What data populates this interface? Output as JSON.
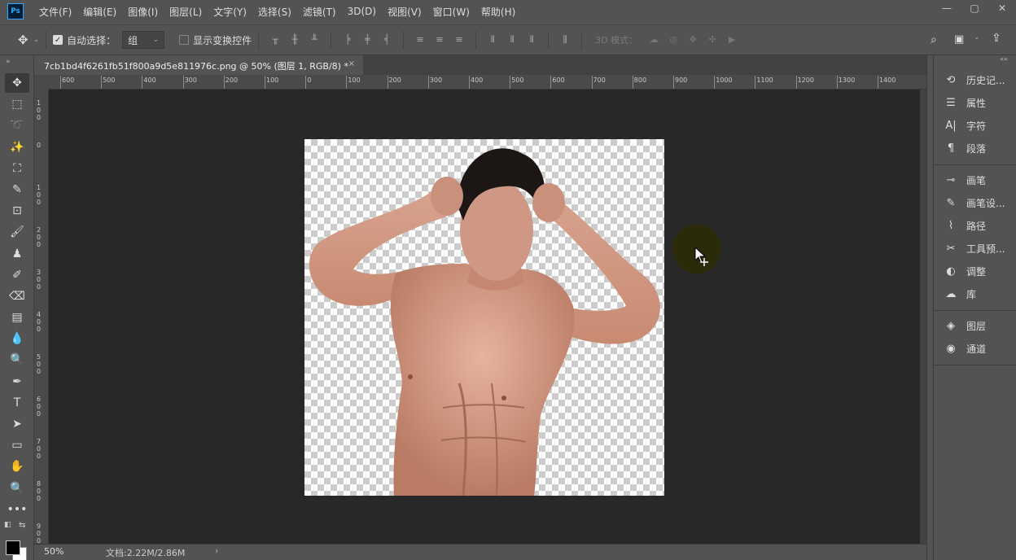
{
  "app": {
    "logo_text": "Ps"
  },
  "menu": [
    "文件(F)",
    "编辑(E)",
    "图像(I)",
    "图层(L)",
    "文字(Y)",
    "选择(S)",
    "滤镜(T)",
    "3D(D)",
    "视图(V)",
    "窗口(W)",
    "帮助(H)"
  ],
  "window_controls": {
    "minimize": "—",
    "restore": "▢",
    "close": "✕"
  },
  "options": {
    "auto_select_label": "自动选择：",
    "auto_select_checked": true,
    "group_value": "组",
    "show_transform_label": "显示变换控件",
    "show_transform_checked": false,
    "mode_3d_label": "3D 模式："
  },
  "document": {
    "tab_title": "7cb1bd4f6261fb51f800a9d5e811976c.png @ 50% (图层 1, RGB/8) *",
    "close_glyph": "×"
  },
  "rulers": {
    "top_labels": [
      "600",
      "500",
      "400",
      "300",
      "200",
      "100",
      "0",
      "100",
      "200",
      "300",
      "400",
      "500",
      "600",
      "700",
      "800",
      "900",
      "1000",
      "1100",
      "1200",
      "1300",
      "1400"
    ],
    "left_labels": [
      "100",
      "0",
      "100",
      "200",
      "300",
      "400",
      "500",
      "600",
      "700",
      "800",
      "900"
    ]
  },
  "tools": [
    {
      "name": "move-tool-icon",
      "glyph": "✥",
      "active": true
    },
    {
      "name": "marquee-tool-icon",
      "glyph": "⬚"
    },
    {
      "name": "lasso-tool-icon",
      "glyph": "➰"
    },
    {
      "name": "magic-wand-tool-icon",
      "glyph": "✨"
    },
    {
      "name": "crop-tool-icon",
      "glyph": "⛶"
    },
    {
      "name": "eyedropper-tool-icon",
      "glyph": "✎"
    },
    {
      "name": "patch-tool-icon",
      "glyph": "⊡"
    },
    {
      "name": "brush-tool-icon",
      "glyph": "🖌"
    },
    {
      "name": "clone-stamp-tool-icon",
      "glyph": "♟"
    },
    {
      "name": "history-brush-tool-icon",
      "glyph": "✐"
    },
    {
      "name": "eraser-tool-icon",
      "glyph": "⌫"
    },
    {
      "name": "gradient-tool-icon",
      "glyph": "▤"
    },
    {
      "name": "blur-tool-icon",
      "glyph": "💧"
    },
    {
      "name": "dodge-tool-icon",
      "glyph": "🔍"
    },
    {
      "name": "pen-tool-icon",
      "glyph": "✒"
    },
    {
      "name": "type-tool-icon",
      "glyph": "T"
    },
    {
      "name": "path-selection-tool-icon",
      "glyph": "➤"
    },
    {
      "name": "rectangle-tool-icon",
      "glyph": "▭"
    },
    {
      "name": "hand-tool-icon",
      "glyph": "✋"
    },
    {
      "name": "zoom-tool-icon",
      "glyph": "🔍"
    },
    {
      "name": "more-tools-icon",
      "glyph": "•••"
    }
  ],
  "panels": [
    [
      {
        "name": "history-panel",
        "icon": "history-icon",
        "glyph": "⟲",
        "label": "历史记..."
      },
      {
        "name": "properties-panel",
        "icon": "properties-icon",
        "glyph": "☰",
        "label": "属性"
      },
      {
        "name": "character-panel",
        "icon": "character-icon",
        "glyph": "A|",
        "label": "字符"
      },
      {
        "name": "paragraph-panel",
        "icon": "paragraph-icon",
        "glyph": "¶",
        "label": "段落"
      }
    ],
    [
      {
        "name": "brush-panel",
        "icon": "brush-icon",
        "glyph": "⊸",
        "label": "画笔"
      },
      {
        "name": "brush-settings-panel",
        "icon": "brush-settings-icon",
        "glyph": "✎",
        "label": "画笔设..."
      },
      {
        "name": "paths-panel",
        "icon": "paths-icon",
        "glyph": "⌇",
        "label": "路径"
      },
      {
        "name": "tool-presets-panel",
        "icon": "tool-presets-icon",
        "glyph": "✂",
        "label": "工具预..."
      },
      {
        "name": "adjustments-panel",
        "icon": "adjustments-icon",
        "glyph": "◐",
        "label": "调整"
      },
      {
        "name": "libraries-panel",
        "icon": "libraries-icon",
        "glyph": "☁",
        "label": "库"
      }
    ],
    [
      {
        "name": "layers-panel",
        "icon": "layers-icon",
        "glyph": "◈",
        "label": "图层"
      },
      {
        "name": "channels-panel",
        "icon": "channels-icon",
        "glyph": "◉",
        "label": "通道"
      }
    ]
  ],
  "status": {
    "zoom": "50%",
    "doc_info": "文档:2.22M/2.86M",
    "arrow": "›"
  },
  "colors": {
    "foreground": "#000000",
    "background": "#ffffff",
    "ui_bg": "#535353",
    "pasteboard": "#282828"
  }
}
